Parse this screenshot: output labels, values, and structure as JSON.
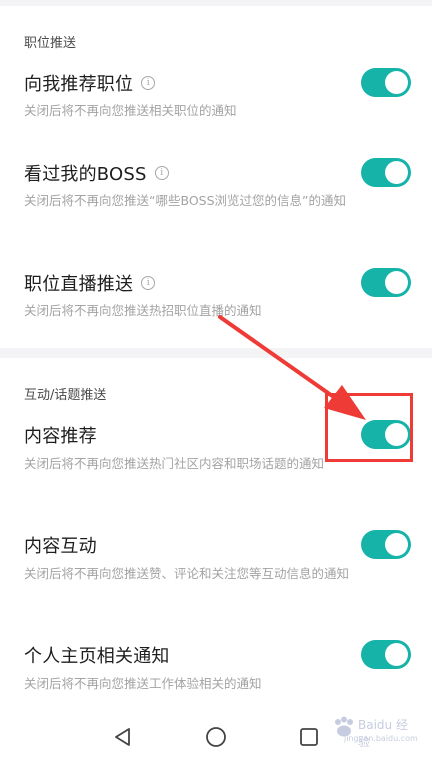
{
  "sections": [
    {
      "title": "职位推送",
      "items": [
        {
          "title": "向我推荐职位",
          "desc": "关闭后将不再向您推送相关职位的通知",
          "enabled": true,
          "has_info": true
        },
        {
          "title": "看过我的BOSS",
          "desc": "关闭后将不再向您推送“哪些BOSS浏览过您的信息”的通知",
          "enabled": true,
          "has_info": true
        },
        {
          "title": "职位直播推送",
          "desc": "关闭后将不再向您推送热招职位直播的通知",
          "enabled": true,
          "has_info": true
        }
      ]
    },
    {
      "title": "互动/话题推送",
      "items": [
        {
          "title": "内容推荐",
          "desc": "关闭后将不再向您推送热门社区内容和职场话题的通知",
          "enabled": true,
          "has_info": false
        },
        {
          "title": "内容互动",
          "desc": "关闭后将不再向您推送赞、评论和关注您等互动信息的通知",
          "enabled": true,
          "has_info": false
        },
        {
          "title": "个人主页相关通知",
          "desc": "关闭后将不再向您推送工作体验相关的通知",
          "enabled": true,
          "has_info": false
        }
      ]
    }
  ],
  "icons": {
    "info": "info-circle-icon",
    "back": "triangle-back-icon",
    "home": "circle-home-icon",
    "recents": "square-recents-icon"
  },
  "colors": {
    "toggle_on": "#15b3a8",
    "annotation": "#ee3b35"
  },
  "watermark": {
    "text": "Baidu 经验",
    "sub": "jingyan.baidu.com"
  }
}
